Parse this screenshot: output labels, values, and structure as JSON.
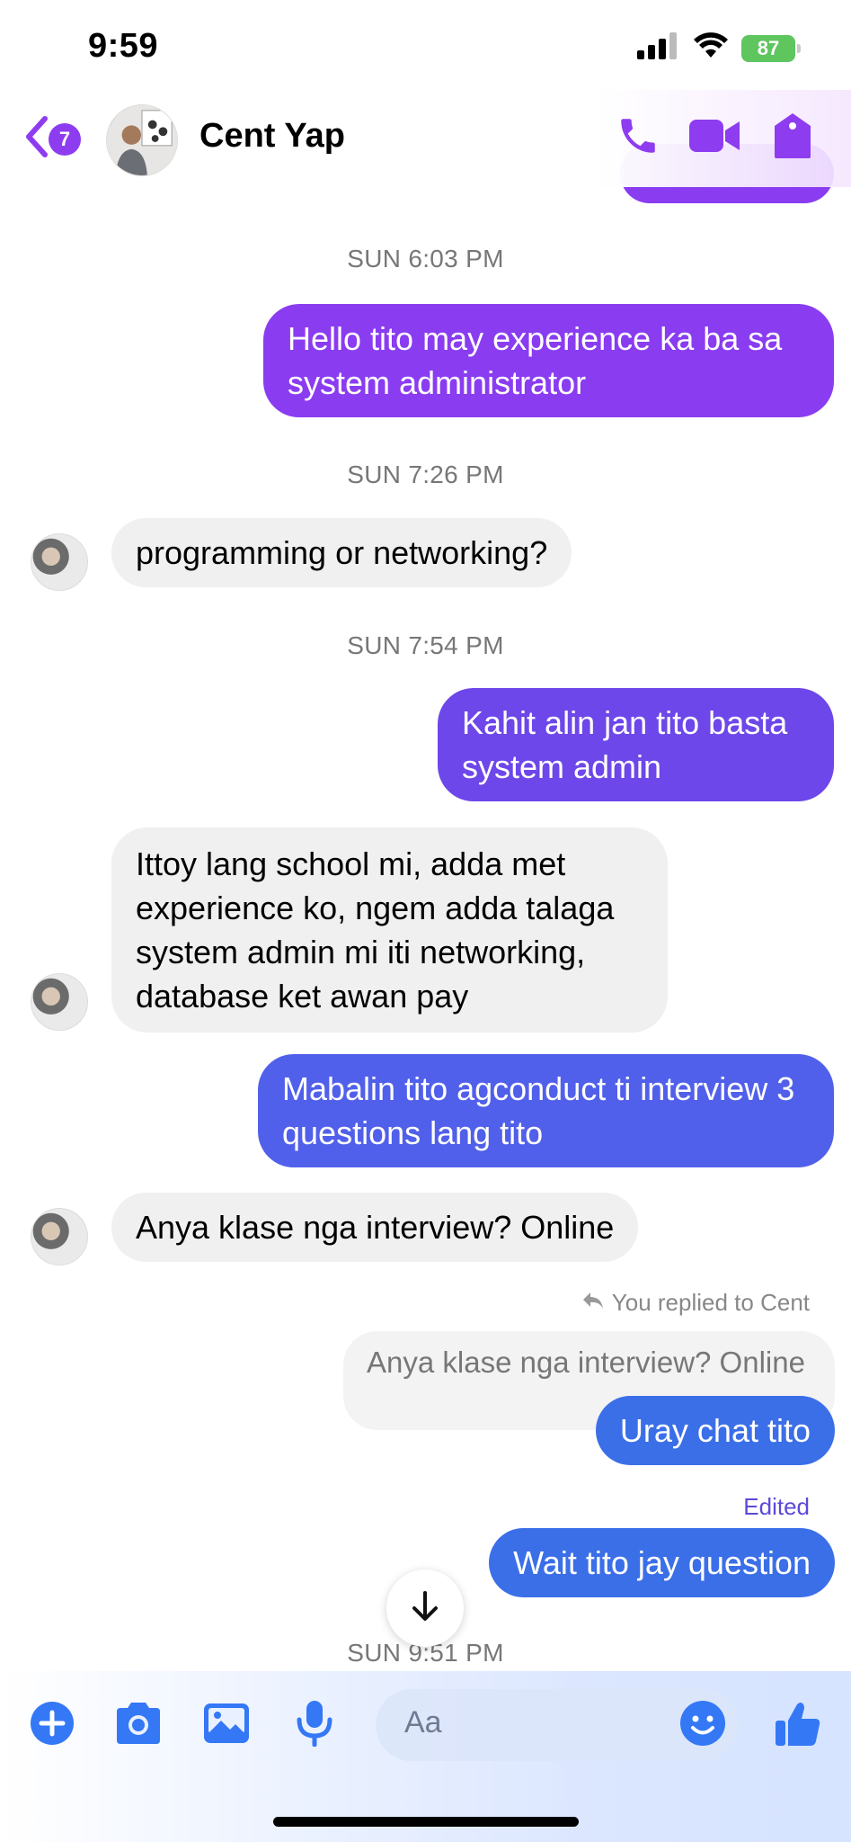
{
  "status": {
    "time": "9:59",
    "battery": "87"
  },
  "header": {
    "back_count": "7",
    "contact_name": "Cent Yap"
  },
  "messages": {
    "ts1": "SUN 6:03 PM",
    "m1": "Hello tito may experience ka ba sa system administrator",
    "ts2": "SUN 7:26 PM",
    "m2": "programming or networking?",
    "ts3": "SUN 7:54 PM",
    "m3": "Kahit alin jan tito basta system admin",
    "m4": "Ittoy lang school mi, adda met experience ko, ngem adda talaga system admin mi iti networking, database ket awan pay",
    "m5": "Mabalin tito agconduct ti interview 3 questions lang tito",
    "m6": "Anya klase nga interview? Online",
    "reply_meta": "You replied to Cent",
    "quoted": "Anya klase nga interview? Online",
    "m7": "Uray chat tito",
    "edited": "Edited",
    "m8": "Wait tito jay question",
    "ts4": "SUN 9:51 PM"
  },
  "composer": {
    "placeholder": "Aa"
  },
  "colors": {
    "accent": "#8e3cf0",
    "bubble_purple": "#8a3cf1",
    "bubble_violet": "#6d47e9",
    "bubble_indigo": "#5160ea",
    "bubble_blue": "#3b6fe8",
    "composer_blue": "#3478f6"
  },
  "icons": [
    "chevron-left-icon",
    "phone-icon",
    "video-icon",
    "shield-icon",
    "arrow-down-icon",
    "plus-icon",
    "camera-icon",
    "image-icon",
    "microphone-icon",
    "emoji-icon",
    "thumbs-up-icon",
    "reply-icon"
  ]
}
